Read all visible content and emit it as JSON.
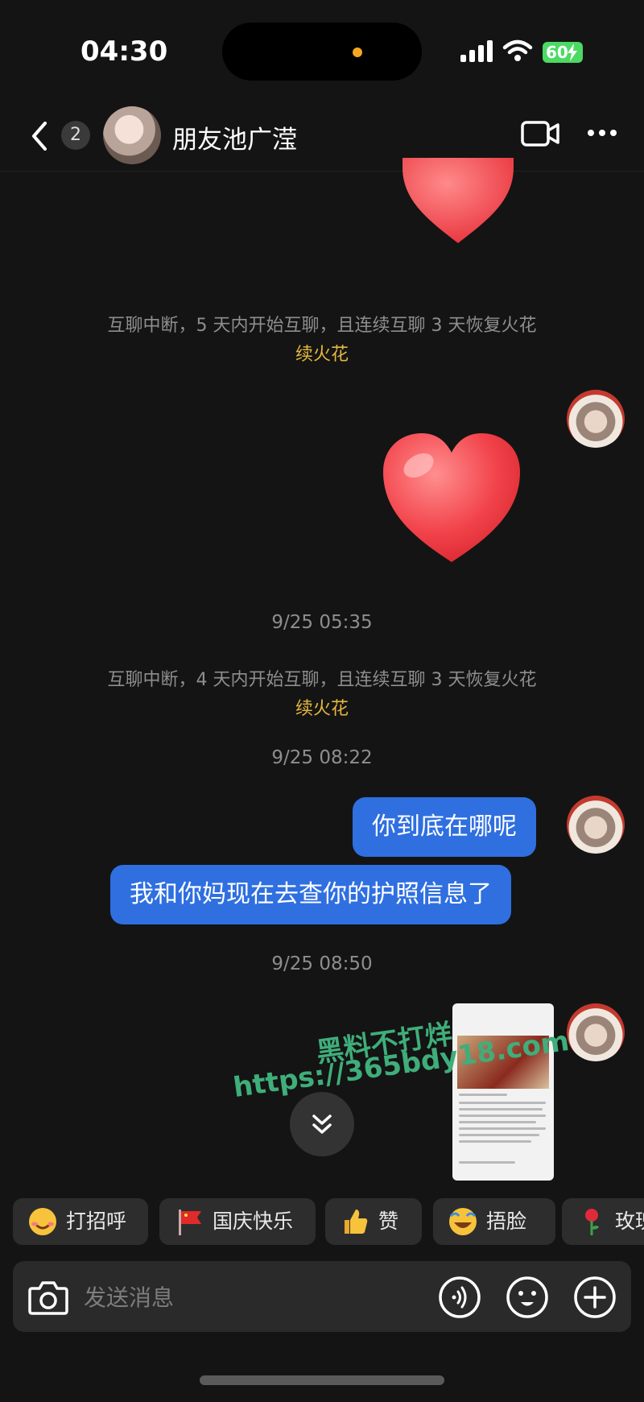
{
  "status_bar": {
    "time": "04:30",
    "battery": "60"
  },
  "header": {
    "unread_count": "2",
    "contact_name": "朋友池广滢"
  },
  "messages": {
    "notice_1": "互聊中断，5 天内开始互聊，且连续互聊 3 天恢复火花",
    "notice_1_link": "续火花",
    "time_1": "9/25 05:35",
    "notice_2": "互聊中断，4 天内开始互聊，且连续互聊 3 天恢复火花",
    "notice_2_link": "续火花",
    "time_2": "9/25 08:22",
    "bubble_1": "你到底在哪呢",
    "bubble_2": "我和你妈现在去查你的护照信息了",
    "time_3": "9/25 08:50"
  },
  "watermark": {
    "line1": "黑料不打烊",
    "line2": "https://365bdy18.com"
  },
  "quick_replies": [
    {
      "label": "打招呼",
      "icon": "smile-emoji-icon"
    },
    {
      "label": "国庆快乐",
      "icon": "red-flag-icon"
    },
    {
      "label": "赞",
      "icon": "thumbs-up-icon"
    },
    {
      "label": "捂脸",
      "icon": "facepalm-emoji-icon"
    },
    {
      "label": "玫瑰",
      "icon": "rose-icon"
    }
  ],
  "input": {
    "placeholder": "发送消息"
  },
  "colors": {
    "bubble": "#2f6fe0",
    "spark_link": "#e4b73d",
    "background": "#141414"
  }
}
